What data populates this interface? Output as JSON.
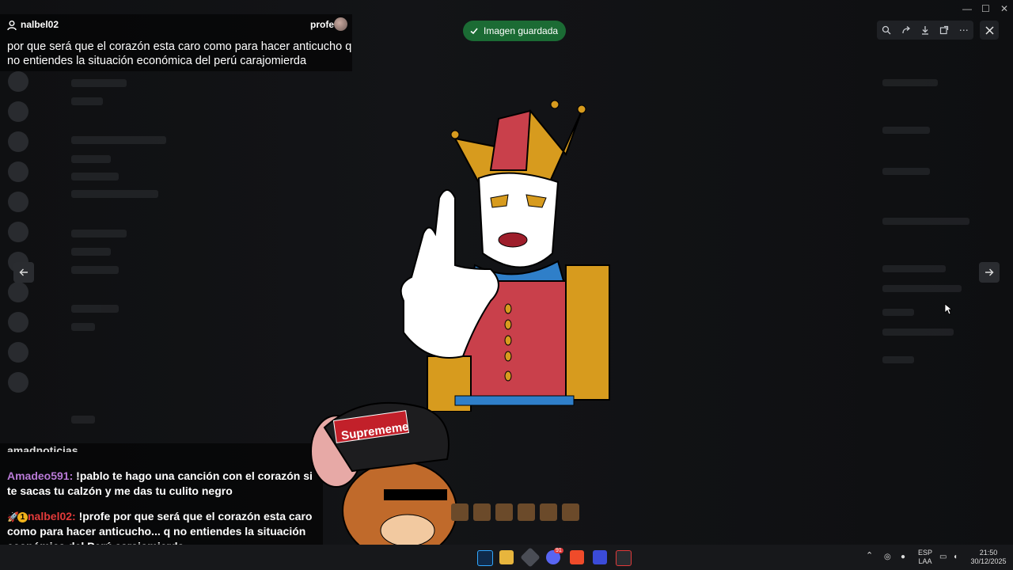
{
  "overlay": {
    "username": "nalbel02",
    "profe": "profe",
    "message": "por que será que el corazón esta caro como para hacer anticucho q no entiendes la situación económica del perú carajomierda"
  },
  "toast": {
    "text": "Imagen guardada"
  },
  "image": {
    "cap_text": "Suprememe"
  },
  "chat": {
    "cut_line": "amadnoticias",
    "messages": [
      {
        "user": "Amadeo591:",
        "text": " !pablo te hago una canción con el corazón si te sacas tu calzón y me das tu culito negro"
      },
      {
        "badge": "1",
        "user": "nalbel02:",
        "text": " !profe por que será que el corazón esta caro como para hacer anticucho... q no entiendes la situación económica del Perú carajomierda"
      }
    ]
  },
  "taskbar": {
    "lang_top": "ESP",
    "lang_bottom": "LAA",
    "time": "21:50",
    "date": "30/12/2025",
    "discord_badge": "91"
  },
  "icons": [
    "user-icon",
    "check-icon",
    "zoom-icon",
    "share-icon",
    "download-icon",
    "open-external-icon",
    "more-icon",
    "close-icon",
    "arrow-left-icon",
    "arrow-right-icon"
  ],
  "colors": {
    "toast_bg": "#1b6b34",
    "amadeo": "#b87ad6",
    "nalbel": "#e23a3a"
  }
}
